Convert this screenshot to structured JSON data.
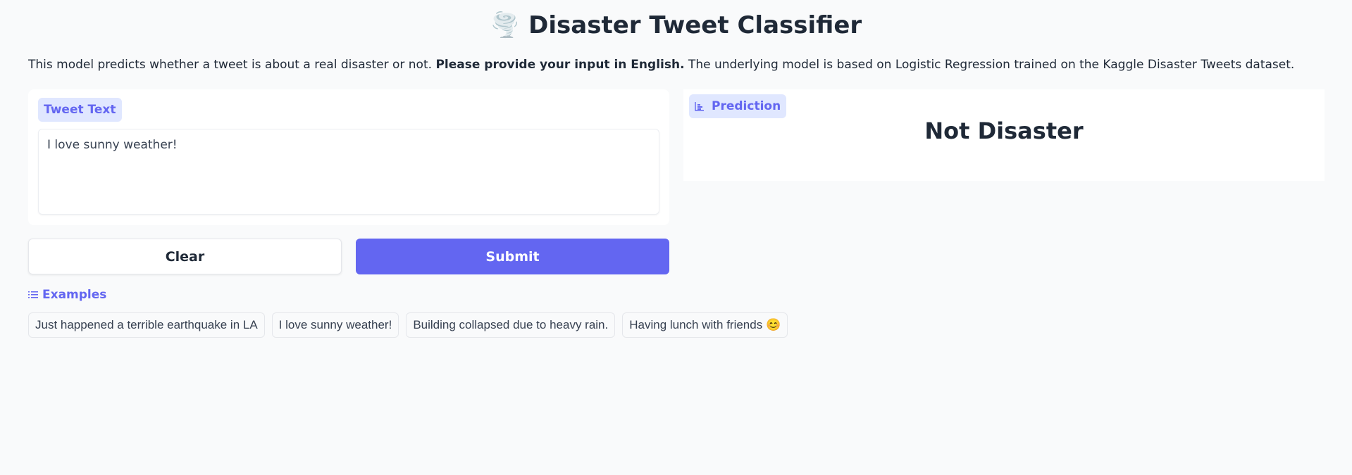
{
  "header": {
    "emoji": "🌪️",
    "title": "Disaster Tweet Classifier"
  },
  "description": {
    "part1": "This model predicts whether a tweet is about a real disaster or not. ",
    "bold": "Please provide your input in English.",
    "part2": " The underlying model is based on Logistic Regression trained on the Kaggle Disaster Tweets dataset."
  },
  "input": {
    "label": "Tweet Text",
    "value": "I love sunny weather!"
  },
  "output": {
    "label": "Prediction",
    "icon": "bar-chart-icon",
    "value": "Not Disaster"
  },
  "buttons": {
    "clear": "Clear",
    "submit": "Submit"
  },
  "examples": {
    "label": "Examples",
    "icon": "list-icon",
    "items": [
      "Just happened a terrible earthquake in LA",
      "I love sunny weather!",
      "Building collapsed due to heavy rain.",
      "Having lunch with friends 😊"
    ]
  },
  "colors": {
    "accent": "#6366f1",
    "accent_light": "#e0e7ff",
    "background": "#f9fafb"
  }
}
